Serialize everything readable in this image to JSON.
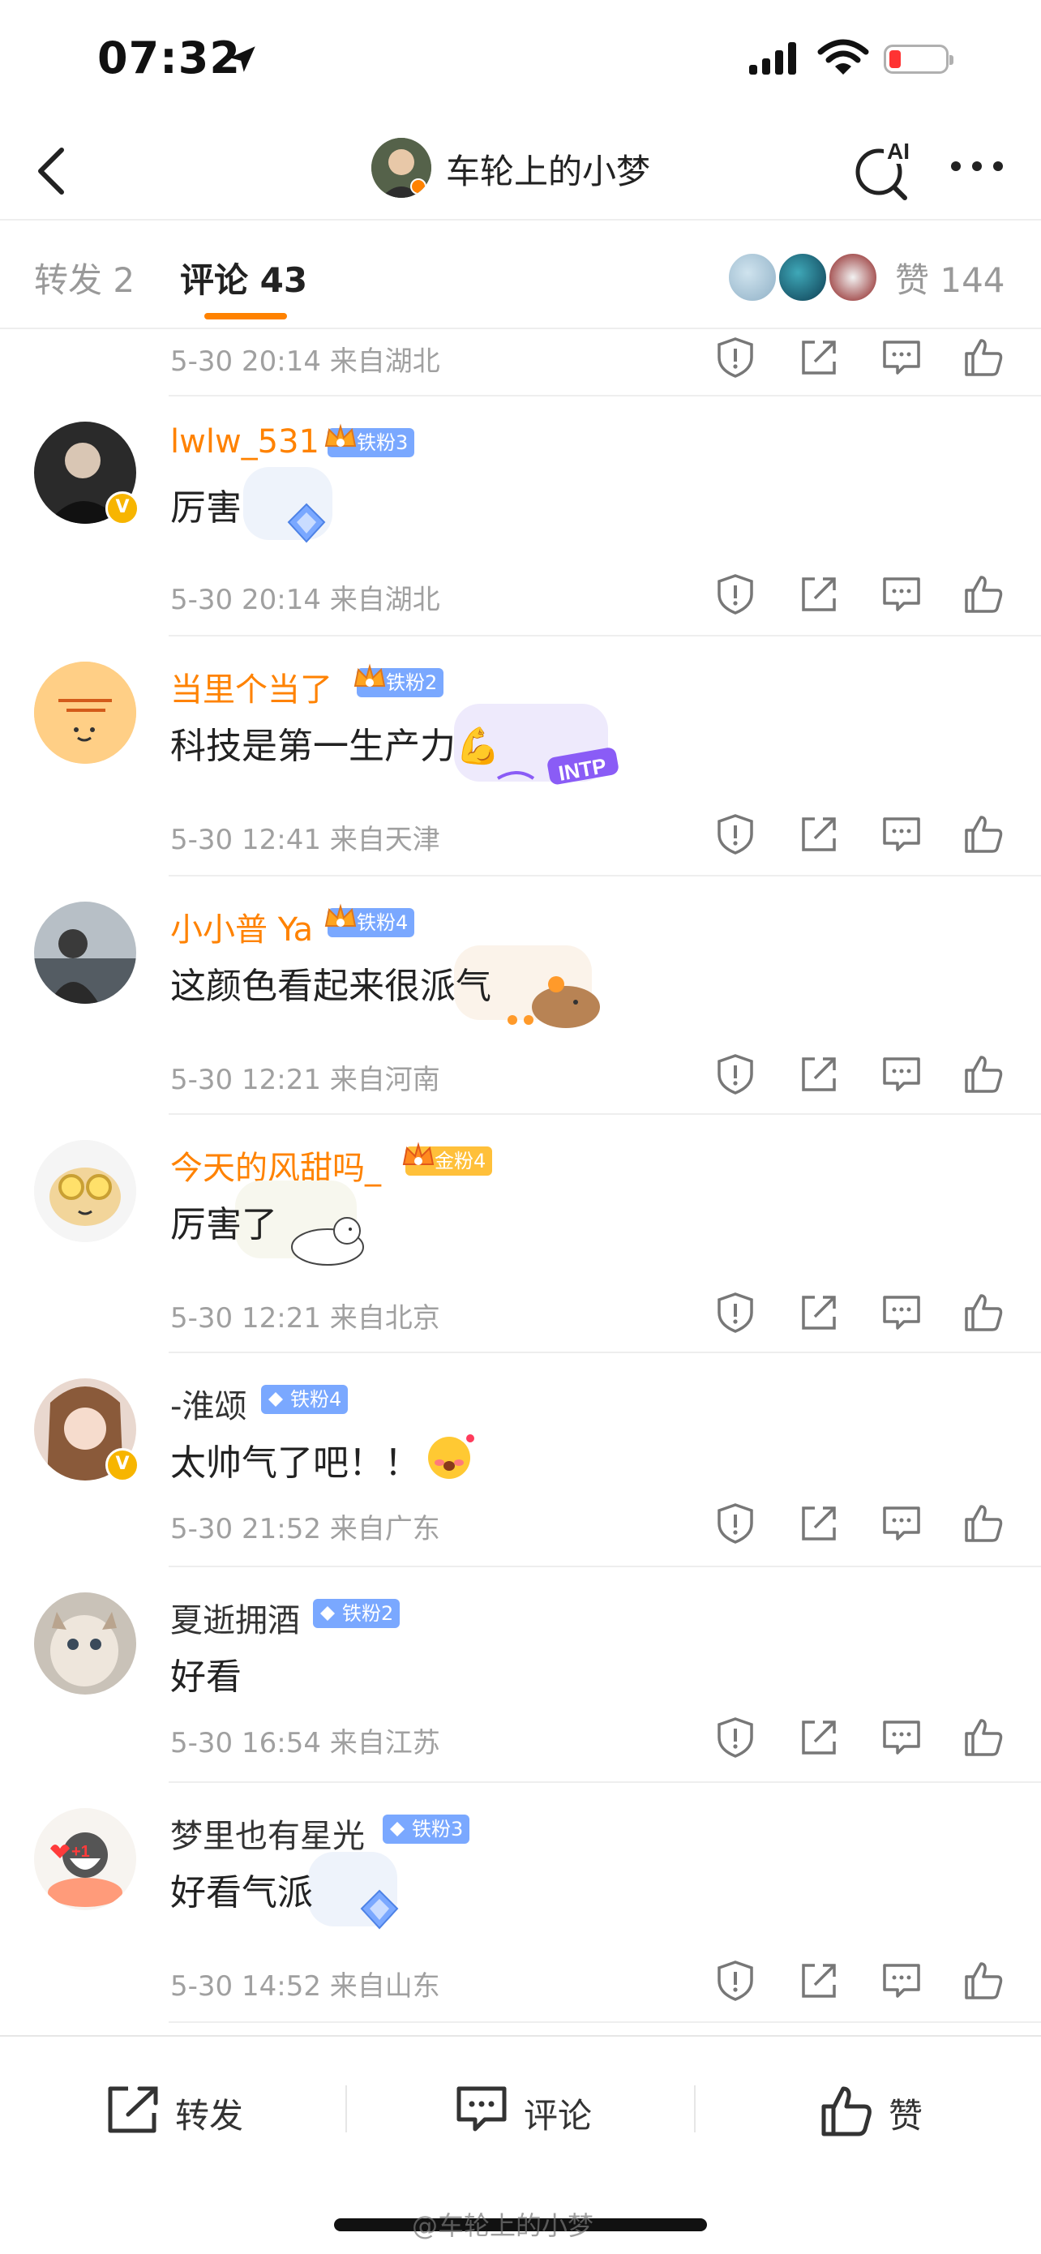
{
  "status_bar": {
    "time": "07:32"
  },
  "nav": {
    "title": "车轮上的小梦",
    "ai_label": "AI"
  },
  "tabs": {
    "repost": "转发 2",
    "comment": "评论 43",
    "likes": "赞 144"
  },
  "icons": {
    "report": "report-icon",
    "share": "share-icon",
    "reply": "comment-icon",
    "like": "like-icon"
  },
  "colors": {
    "accent": "#ff8200",
    "name_orange": "#ff8200",
    "meta_gray": "#a0a0a0",
    "fan_blue": "#7aa8ff",
    "fan_gold": "#ffc03a"
  },
  "first_meta": "5-30 20:14  来自湖北",
  "comments": [
    {
      "name": "lwlw_531",
      "fan": "铁粉3",
      "text": "厉害",
      "meta": "5-30 20:14  来自湖北"
    },
    {
      "name": "当里个当了",
      "fan": "铁粉2",
      "text": "科技是第一生产力💪",
      "meta": "5-30 12:41  来自天津",
      "sticker": "INTP"
    },
    {
      "name": "小小普 Ya",
      "fan": "铁粉4",
      "text": "这颜色看起来很派气",
      "meta": "5-30 12:21  来自河南"
    },
    {
      "name": "今天的风甜吗_",
      "fan": "金粉4",
      "text": "厉害了",
      "meta": "5-30 12:21  来自北京"
    },
    {
      "name": "-淮颂",
      "fan": "铁粉4",
      "text": "太帅气了吧！！",
      "meta": "5-30 21:52  来自广东"
    },
    {
      "name": "夏逝拥酒",
      "fan": "铁粉2",
      "text": "好看",
      "meta": "5-30 16:54  来自江苏"
    },
    {
      "name": "梦里也有星光",
      "fan": "铁粉3",
      "text": "好看气派",
      "meta": "5-30 14:52  来自山东",
      "avatar_text": "+1"
    }
  ],
  "bottom_bar": {
    "repost": "转发",
    "comment": "评论",
    "like": "赞"
  },
  "watermark": "@车轮上的小梦"
}
